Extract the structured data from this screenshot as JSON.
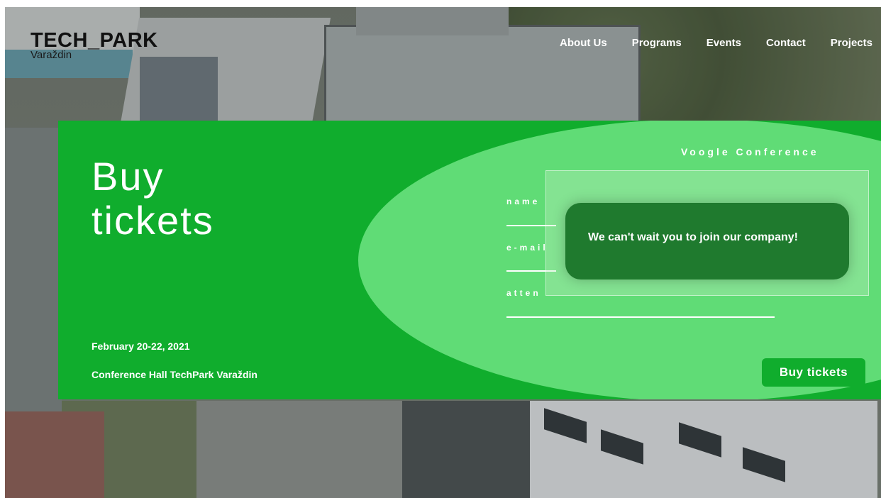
{
  "logo": {
    "main": "TECH_PARK",
    "sub": "Varaždin"
  },
  "nav": {
    "items": [
      {
        "label": "About Us"
      },
      {
        "label": "Programs"
      },
      {
        "label": "Events"
      },
      {
        "label": "Contact"
      },
      {
        "label": "Projects"
      }
    ]
  },
  "banner": {
    "title_line1": "Buy",
    "title_line2": "tickets",
    "date": "February 20-22, 2021",
    "venue": "Conference Hall TechPark Varaždin",
    "conference": "Voogle Conference",
    "form": {
      "name_label": "name",
      "email_label": "e-mail",
      "attendees_label": "atten"
    },
    "buy_button": "Buy tickets"
  },
  "popup": {
    "message": "We can't wait you to join our company!"
  },
  "colors": {
    "banner_green": "#10ad2d",
    "ellipse_green": "#60dc76",
    "popup_green": "#1f7a2e"
  }
}
